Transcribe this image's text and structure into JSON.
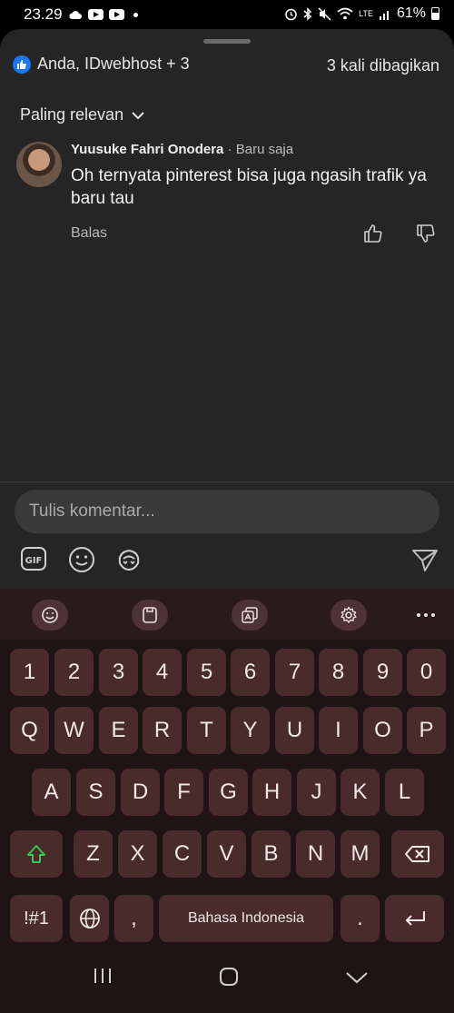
{
  "status_bar": {
    "time": "23.29",
    "battery": "61%",
    "network": "LTE"
  },
  "sheet": {
    "reactions_text": "Anda, IDwebhost + 3",
    "shares_text": "3 kali dibagikan",
    "sort_label": "Paling relevan"
  },
  "comment": {
    "author": "Yuusuke Fahri Onodera",
    "time": "· Baru saja",
    "text": "Oh ternyata pinterest bisa juga ngasih trafik ya baru tau",
    "reply_label": "Balas"
  },
  "composer": {
    "placeholder": "Tulis komentar..."
  },
  "keyboard": {
    "row_numbers": [
      "1",
      "2",
      "3",
      "4",
      "5",
      "6",
      "7",
      "8",
      "9",
      "0"
    ],
    "row_q": [
      "Q",
      "W",
      "E",
      "R",
      "T",
      "Y",
      "U",
      "I",
      "O",
      "P"
    ],
    "row_a": [
      "A",
      "S",
      "D",
      "F",
      "G",
      "H",
      "J",
      "K",
      "L"
    ],
    "row_z": [
      "Z",
      "X",
      "C",
      "V",
      "B",
      "N",
      "M"
    ],
    "symbols_label": "!#1",
    "comma_label": ",",
    "space_label": "Bahasa Indonesia",
    "period_label": "."
  },
  "colors": {
    "brand_blue": "#1877f2",
    "key": "#4a2b2b",
    "shift_green": "#33c75a"
  }
}
